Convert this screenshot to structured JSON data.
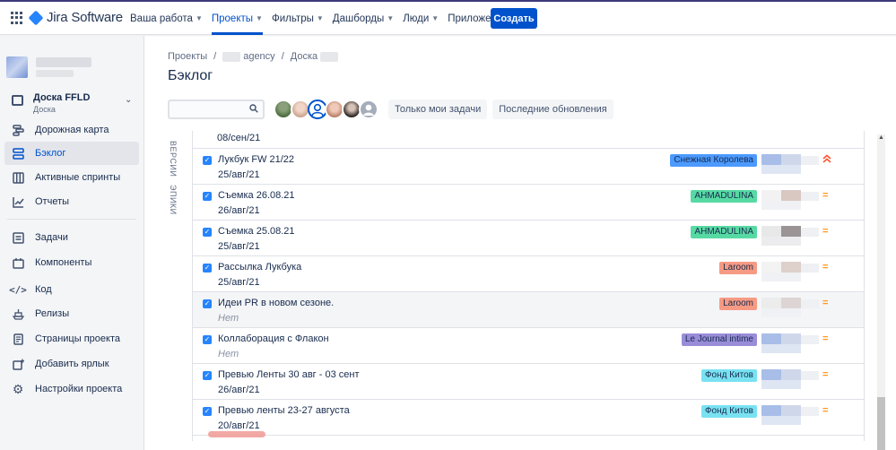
{
  "topnav": {
    "logo": "Jira Software",
    "menu": [
      {
        "label": "Ваша работа"
      },
      {
        "label": "Проекты"
      },
      {
        "label": "Фильтры"
      },
      {
        "label": "Дашборды"
      },
      {
        "label": "Люди"
      },
      {
        "label": "Приложения"
      }
    ],
    "create": "Создать"
  },
  "sidebar": {
    "board": {
      "name": "Доска FFLD",
      "sub": "Доска"
    },
    "items": [
      {
        "label": "Дорожная карта"
      },
      {
        "label": "Бэклог"
      },
      {
        "label": "Активные спринты"
      },
      {
        "label": "Отчеты"
      },
      {
        "label": "Задачи"
      },
      {
        "label": "Компоненты"
      },
      {
        "label": "Код"
      },
      {
        "label": "Релизы"
      },
      {
        "label": "Страницы проекта"
      },
      {
        "label": "Добавить ярлык"
      },
      {
        "label": "Настройки проекта"
      }
    ]
  },
  "breadcrumb": {
    "projects": "Проекты",
    "agency": "agency",
    "board": "Доска"
  },
  "title": "Бэклог",
  "filters": {
    "only_mine": "Только мои задачи",
    "recent": "Последние обновления",
    "search_value": ""
  },
  "vtabs": {
    "versions": "ВЕРСИИ",
    "epics": "ЭПИКИ"
  },
  "backlog": {
    "first_date": "08/сен/21",
    "rows": [
      {
        "summary": "Лукбук FW 21/22",
        "date": "25/авг/21",
        "epic": "Снежная Королева",
        "epic_color": "#4c9aff",
        "priority": "high"
      },
      {
        "summary": "Съемка 26.08.21",
        "date": "26/авг/21",
        "epic": "AHMADULINA",
        "epic_color": "#57d9a3",
        "priority": "medium"
      },
      {
        "summary": "Съемка 25.08.21",
        "date": "25/авг/21",
        "epic": "AHMADULINA",
        "epic_color": "#57d9a3",
        "priority": "medium"
      },
      {
        "summary": "Рассылка Лукбука",
        "date": "25/авг/21",
        "epic": "Laroom",
        "epic_color": "#f79a84",
        "priority": "medium"
      },
      {
        "summary": "Идеи PR в новом сезоне.",
        "date": "Нет",
        "epic": "Laroom",
        "epic_color": "#f79a84",
        "priority": "medium"
      },
      {
        "summary": "Коллаборация с Флакон",
        "date": "Нет",
        "epic": "Le Journal intime",
        "epic_color": "#998dd9",
        "priority": "medium"
      },
      {
        "summary": "Превью Ленты 30 авг - 03 сент",
        "date": "26/авг/21",
        "epic": "Фонд Китов",
        "epic_color": "#79e2f2",
        "priority": "medium"
      },
      {
        "summary": "Превью ленты 23-27 августа",
        "date": "20/авг/21",
        "epic": "Фонд Китов",
        "epic_color": "#79e2f2",
        "priority": "medium"
      }
    ]
  },
  "icons": {
    "priority_medium": "=",
    "priority_high": "^"
  }
}
